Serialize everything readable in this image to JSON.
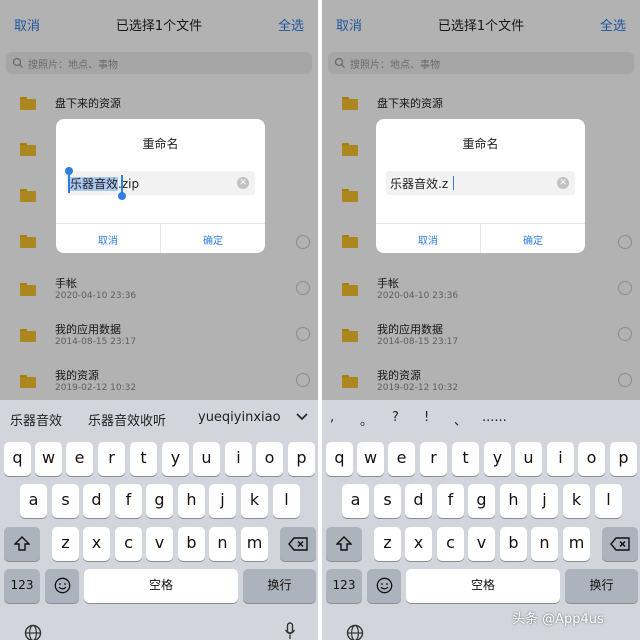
{
  "panels": [
    {
      "header": {
        "cancel": "取消",
        "title": "已选择1个文件",
        "select_all": "全选"
      },
      "search": {
        "placeholder": "搜照片：地点、事物"
      },
      "files": [
        {
          "name": "盘下来的资源",
          "date": ""
        },
        {
          "name": "",
          "date": ""
        },
        {
          "name": "",
          "date": ""
        },
        {
          "name": "",
          "date": ""
        },
        {
          "name": "手帐",
          "date": "2020-04-10 23:36"
        },
        {
          "name": "我的应用数据",
          "date": "2014-08-15 23:17"
        },
        {
          "name": "我的资源",
          "date": "2019-02-12 10:32"
        }
      ],
      "dialog": {
        "title": "重命名",
        "selected_text": "乐器音效",
        "rest_text": ".zip",
        "cancel": "取消",
        "confirm": "确定"
      },
      "keyboard": {
        "suggestions": [
          "乐器音效",
          "乐器音效收听",
          "yueqiyinxiao"
        ],
        "row1": [
          "q",
          "w",
          "e",
          "r",
          "t",
          "y",
          "u",
          "i",
          "o",
          "p"
        ],
        "row2": [
          "a",
          "s",
          "d",
          "f",
          "g",
          "h",
          "j",
          "k",
          "l"
        ],
        "row3": [
          "z",
          "x",
          "c",
          "v",
          "b",
          "n",
          "m"
        ],
        "num_key": "123",
        "space_key": "空格",
        "return_key": "换行"
      }
    },
    {
      "header": {
        "cancel": "取消",
        "title": "已选择1个文件",
        "select_all": "全选"
      },
      "search": {
        "placeholder": "搜照片：地点、事物"
      },
      "files": [
        {
          "name": "盘下来的资源",
          "date": ""
        },
        {
          "name": "",
          "date": ""
        },
        {
          "name": "",
          "date": ""
        },
        {
          "name": "",
          "date": ""
        },
        {
          "name": "手帐",
          "date": "2020-04-10 23:36"
        },
        {
          "name": "我的应用数据",
          "date": "2014-08-15 23:17"
        },
        {
          "name": "我的资源",
          "date": "2019-02-12 10:32"
        }
      ],
      "dialog": {
        "title": "重命名",
        "selected_text": "",
        "rest_text": "乐器音效.z",
        "cancel": "取消",
        "confirm": "确定"
      },
      "keyboard": {
        "punctuation": [
          ",",
          "。",
          "?",
          "!",
          "、",
          "......"
        ],
        "row1": [
          "q",
          "w",
          "e",
          "r",
          "t",
          "y",
          "u",
          "i",
          "o",
          "p"
        ],
        "row2": [
          "a",
          "s",
          "d",
          "f",
          "g",
          "h",
          "j",
          "k",
          "l"
        ],
        "row3": [
          "z",
          "x",
          "c",
          "v",
          "b",
          "n",
          "m"
        ],
        "num_key": "123",
        "space_key": "空格",
        "return_key": "换行"
      }
    }
  ],
  "watermark": "头条 @App4us",
  "colors": {
    "accent": "#2f7de1",
    "folder": "#f6c12b",
    "keyboard_bg": "#d2d5db"
  }
}
